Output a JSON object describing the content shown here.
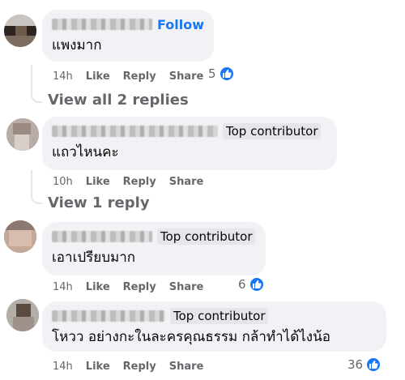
{
  "comments": [
    {
      "badge": "Follow",
      "text": "แพงมาก",
      "time": "14h",
      "like_label": "Like",
      "reply_label": "Reply",
      "share_label": "Share",
      "reaction_count": "5",
      "replies_link": "View all 2 replies"
    },
    {
      "badge": "Top contributor",
      "text": "แถวไหนคะ",
      "time": "10h",
      "like_label": "Like",
      "reply_label": "Reply",
      "share_label": "Share",
      "reaction_count": "",
      "replies_link": "View 1 reply"
    },
    {
      "badge": "Top contributor",
      "text": "เอาเปรียบมาก",
      "time": "14h",
      "like_label": "Like",
      "reply_label": "Reply",
      "share_label": "Share",
      "reaction_count": "6",
      "replies_link": ""
    },
    {
      "badge": "Top contributor",
      "text": "โหวว อย่างกะในละครคุณธรรม กล้าทำได้ไงน้อ",
      "time": "14h",
      "like_label": "Like",
      "reply_label": "Reply",
      "share_label": "Share",
      "reaction_count": "36",
      "replies_link": ""
    }
  ],
  "colors": {
    "bubble": "#f0f2f5",
    "link_blue": "#1877f2",
    "meta_gray": "#65676b"
  },
  "icons": {
    "reaction": "like-thumb-icon"
  }
}
